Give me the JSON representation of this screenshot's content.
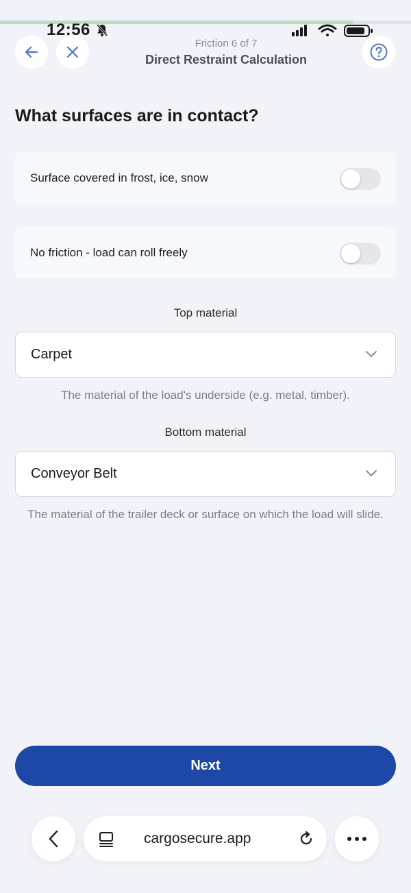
{
  "status_bar": {
    "time": "12:56"
  },
  "progress": {
    "fraction": 0.86,
    "fill_color": "#b9dfc3"
  },
  "header": {
    "step_text": "Friction 6 of 7",
    "title": "Direct Restraint Calculation",
    "back_icon": "arrow-left-icon",
    "close_icon": "close-icon",
    "help_icon": "question-circle-icon",
    "accent_color": "#4f74c9"
  },
  "main": {
    "question": "What surfaces are in contact?",
    "toggles": [
      {
        "label": "Surface covered in frost, ice, snow",
        "on": false
      },
      {
        "label": "No friction - load can roll freely",
        "on": false
      }
    ],
    "top_material": {
      "label": "Top material",
      "value": "Carpet",
      "helper": "The material of the load's underside (e.g. metal, timber)."
    },
    "bottom_material": {
      "label": "Bottom material",
      "value": "Conveyor Belt",
      "helper": "The material of the trailer deck or surface on which the load will slide."
    }
  },
  "footer": {
    "next_label": "Next",
    "button_color": "#1d48a7"
  },
  "browser": {
    "url": "cargosecure.app",
    "back_icon": "chevron-left-icon",
    "tabs_icon": "tabs-icon",
    "reload_icon": "reload-icon",
    "more_icon": "more-dots-icon"
  }
}
